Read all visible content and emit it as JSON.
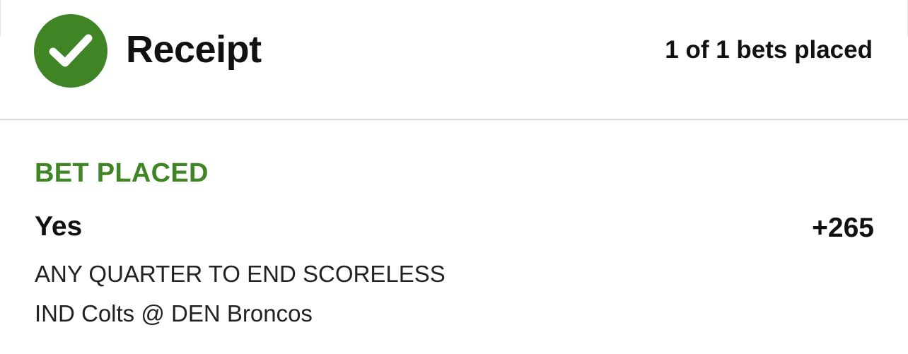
{
  "header": {
    "title": "Receipt",
    "bets_summary": "1 of 1 bets placed",
    "status_icon": "checkmark-circle-icon",
    "accent_color": "#3f8526"
  },
  "bet": {
    "status": "BET PLACED",
    "status_color": "#3f8526",
    "selection": "Yes",
    "odds": "+265",
    "market": "ANY QUARTER TO END SCORELESS",
    "event": "IND Colts @ DEN Broncos"
  }
}
